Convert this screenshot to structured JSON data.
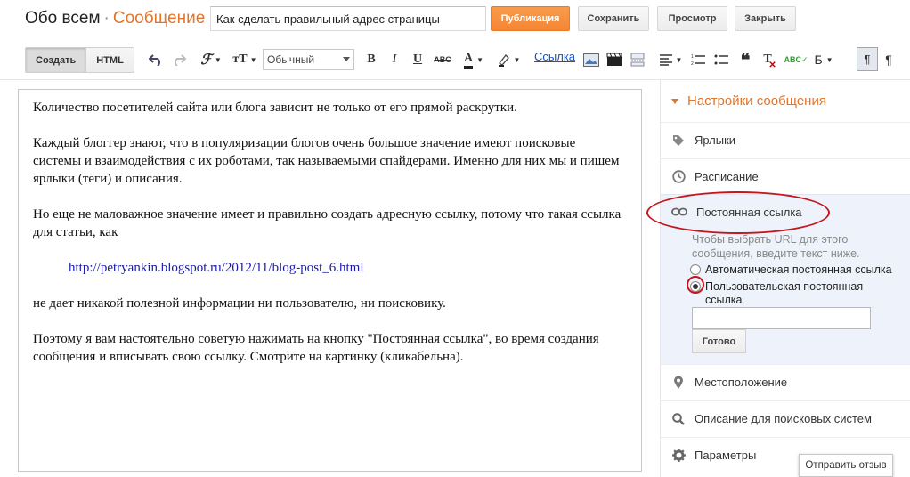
{
  "header": {
    "blog_name": "Обо всем",
    "separator": "·",
    "page_type": "Сообщение",
    "post_title": "Как сделать правильный адрес страницы",
    "publish_label": "Публикация",
    "save_label": "Сохранить",
    "preview_label": "Просмотр",
    "close_label": "Закрыть"
  },
  "toolbar": {
    "compose_label": "Создать",
    "html_label": "HTML",
    "font_size_glyph": "тT",
    "format_value": "Обычный",
    "bold": "B",
    "italic": "I",
    "underline": "U",
    "strike": "ABC",
    "text_color": "A",
    "link_label": "Ссылка",
    "translit": "Б",
    "para_glyph": "¶",
    "icons": [
      "undo-icon",
      "redo-icon",
      "font-family-icon",
      "font-size-icon",
      "text-color-icon",
      "highlight-icon",
      "image-icon",
      "video-icon",
      "jump-break-icon",
      "align-icon",
      "numbered-list-icon",
      "bulleted-list-icon",
      "quote-icon",
      "clear-format-icon",
      "spellcheck-icon",
      "ltr-icon"
    ]
  },
  "editor": {
    "paragraphs": [
      "Количество посетителей сайта или блога зависит не только от его прямой раскрутки.",
      "Каждый блоггер знают, что в популяризации блогов очень большое значение имеют поисковые системы и взаимодействия с их роботами, так называемыми спайдерами. Именно для них мы и пишем ярлыки (теги) и описания.",
      "Но еще не маловажное значение имеет и правильно создать адресную ссылку, потому что такая ссылка для статьи, как",
      "http://petryankin.blogspot.ru/2012/11/blog-post_6.html",
      "не дает никакой полезной информации ни пользователю, ни поисковику.",
      "Поэтому я вам настоятельно советую нажимать на кнопку \"Постоянная ссылка\", во время создания сообщения и вписывать свою ссылку. Смотрите на картинку (кликабельна)."
    ]
  },
  "sidebar": {
    "heading": "Настройки сообщения",
    "labels": "Ярлыки",
    "schedule": "Расписание",
    "permalink": {
      "title": "Постоянная ссылка",
      "hint": "Чтобы выбрать URL для этого сообщения, введите текст ниже.",
      "option_auto": "Автоматическая постоянная ссылка",
      "option_custom": "Пользовательская постоянная ссылка",
      "selected": "custom",
      "input_value": "",
      "done_label": "Готово"
    },
    "location": "Местоположение",
    "search_description": "Описание для поисковых систем",
    "options": "Параметры"
  },
  "feedback_label": "Отправить отзыв",
  "colors": {
    "accent": "#e0752d",
    "publish": "#f58634",
    "link": "#1155cc",
    "annotation": "#c4161c"
  }
}
